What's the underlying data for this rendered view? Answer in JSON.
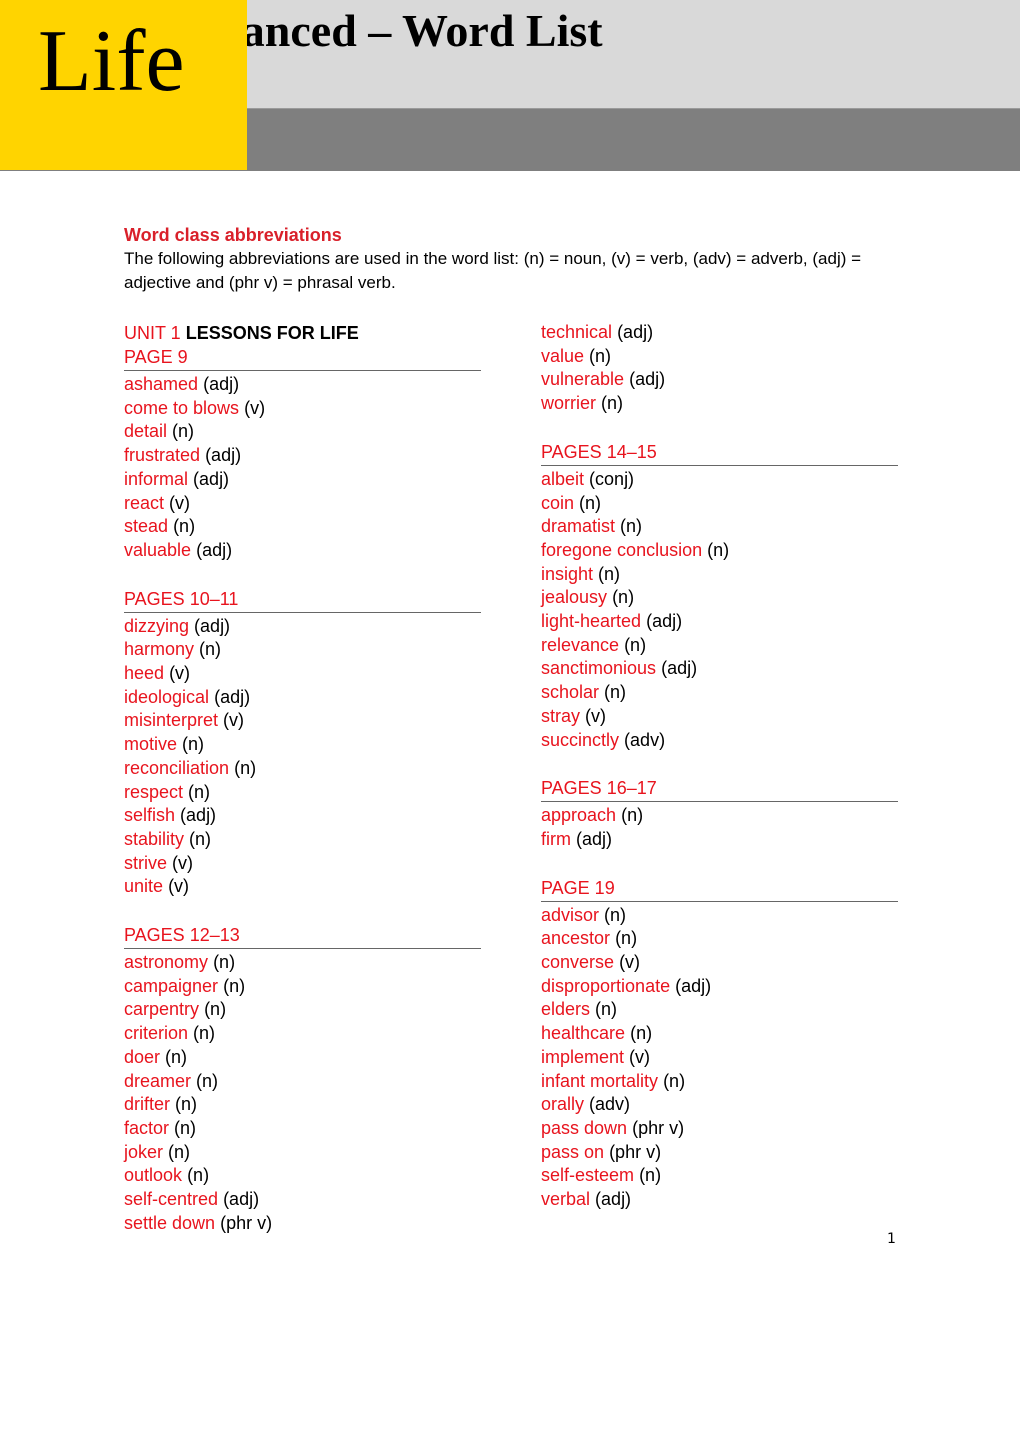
{
  "header": {
    "title": "Advanced – Word List",
    "title_visible": "anced – Word List",
    "logo": "Life",
    "colors": {
      "logo_bg": "#ffd400",
      "band_light": "#d9d9d9",
      "band_dark": "#7f7f7f"
    }
  },
  "intro": {
    "title": "Word class abbreviations",
    "body": "The following abbreviations are used in the word list: (n) = noun, (v) = verb, (adv) = adverb, (adj) = adjective and (phr v) = phrasal verb."
  },
  "unit": {
    "label": "UNIT 1",
    "title": "LESSONS FOR LIFE"
  },
  "left_sections": [
    {
      "heading": "PAGE 9",
      "entries": [
        {
          "word": "ashamed",
          "class": "(adj)"
        },
        {
          "word": "come to blows",
          "class": "(v)"
        },
        {
          "word": "detail",
          "class": "(n)"
        },
        {
          "word": "frustrated",
          "class": "(adj)"
        },
        {
          "word": "informal",
          "class": "(adj)"
        },
        {
          "word": "react",
          "class": "(v)"
        },
        {
          "word": "stead",
          "class": "(n)"
        },
        {
          "word": "valuable",
          "class": "(adj)"
        }
      ]
    },
    {
      "heading": "PAGES 10–11",
      "entries": [
        {
          "word": "dizzying",
          "class": "(adj)"
        },
        {
          "word": "harmony",
          "class": "(n)"
        },
        {
          "word": "heed",
          "class": "(v)"
        },
        {
          "word": "ideological",
          "class": "(adj)"
        },
        {
          "word": "misinterpret",
          "class": "(v)"
        },
        {
          "word": "motive",
          "class": "(n)"
        },
        {
          "word": "reconciliation",
          "class": "(n)"
        },
        {
          "word": "respect",
          "class": "(n)"
        },
        {
          "word": "selfish",
          "class": "(adj)"
        },
        {
          "word": "stability",
          "class": "(n)"
        },
        {
          "word": "strive",
          "class": "(v)"
        },
        {
          "word": "unite",
          "class": "(v)"
        }
      ]
    },
    {
      "heading": "PAGES 12–13",
      "entries": [
        {
          "word": "astronomy",
          "class": "(n)"
        },
        {
          "word": "campaigner",
          "class": "(n)"
        },
        {
          "word": "carpentry",
          "class": "(n)"
        },
        {
          "word": "criterion",
          "class": "(n)"
        },
        {
          "word": "doer",
          "class": "(n)"
        },
        {
          "word": "dreamer",
          "class": "(n)"
        },
        {
          "word": "drifter",
          "class": "(n)"
        },
        {
          "word": "factor",
          "class": "(n)"
        },
        {
          "word": "joker",
          "class": "(n)"
        },
        {
          "word": "outlook",
          "class": "(n)"
        },
        {
          "word": "self-centred",
          "class": "(adj)"
        },
        {
          "word": "settle down",
          "class": "(phr v)"
        }
      ]
    }
  ],
  "right_continuation": [
    {
      "word": "technical",
      "class": "(adj)"
    },
    {
      "word": "value",
      "class": "(n)"
    },
    {
      "word": "vulnerable",
      "class": "(adj)"
    },
    {
      "word": "worrier",
      "class": "(n)"
    }
  ],
  "right_sections": [
    {
      "heading": "PAGES 14–15",
      "entries": [
        {
          "word": "albeit",
          "class": "(conj)"
        },
        {
          "word": "coin",
          "class": "(n)"
        },
        {
          "word": "dramatist",
          "class": "(n)"
        },
        {
          "word": "foregone conclusion",
          "class": "(n)"
        },
        {
          "word": "insight",
          "class": "(n)"
        },
        {
          "word": "jealousy",
          "class": "(n)"
        },
        {
          "word": "light-hearted",
          "class": "(adj)"
        },
        {
          "word": "relevance",
          "class": "(n)"
        },
        {
          "word": "sanctimonious",
          "class": "(adj)"
        },
        {
          "word": "scholar",
          "class": "(n)"
        },
        {
          "word": "stray",
          "class": "(v)"
        },
        {
          "word": "succinctly",
          "class": "(adv)"
        }
      ]
    },
    {
      "heading": "PAGES 16–17",
      "entries": [
        {
          "word": "approach",
          "class": "(n)"
        },
        {
          "word": "firm",
          "class": "(adj)"
        }
      ]
    },
    {
      "heading": "PAGE 19",
      "entries": [
        {
          "word": "advisor",
          "class": "(n)"
        },
        {
          "word": "ancestor",
          "class": "(n)"
        },
        {
          "word": "converse",
          "class": "(v)"
        },
        {
          "word": "disproportionate",
          "class": "(adj)"
        },
        {
          "word": "elders",
          "class": "(n)"
        },
        {
          "word": "healthcare",
          "class": "(n)"
        },
        {
          "word": "implement",
          "class": "(v)"
        },
        {
          "word": "infant mortality",
          "class": "(n)"
        },
        {
          "word": "orally",
          "class": "(adv)"
        },
        {
          "word": "pass down",
          "class": "(phr v)"
        },
        {
          "word": "pass on",
          "class": "(phr v)"
        },
        {
          "word": "self-esteem",
          "class": "(n)"
        },
        {
          "word": "verbal",
          "class": "(adj)"
        }
      ]
    }
  ],
  "footer": {
    "page_number": "1"
  }
}
